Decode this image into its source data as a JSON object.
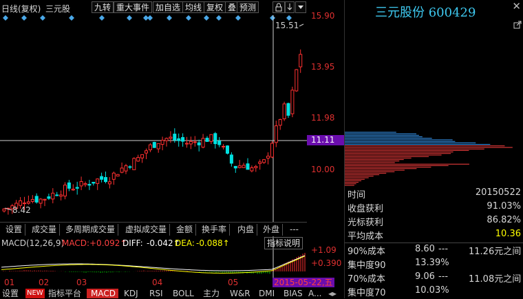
{
  "toolbar": {
    "period": "日线(复权)",
    "stock_name": "三元股",
    "buttons": [
      "九转",
      "重大事件",
      "加自选",
      "均线",
      "复权",
      "叠",
      "预测"
    ],
    "lock_icon": "lock-icon",
    "arrow_icon": "arrow-down-icon",
    "dropdown_icon": "dropdown-icon",
    "close_icon": "close-icon"
  },
  "price_axis": {
    "labels": [
      "15.90",
      "13.95",
      "11.98",
      "10.00"
    ],
    "current_price": "11.11"
  },
  "annotations": {
    "high_label": "15.51",
    "low_label": "8.42"
  },
  "indicator_tabs": [
    "设置",
    "成交量",
    "多周期成交量",
    "虚拟成交量",
    "金额",
    "换手率",
    "内盘",
    "外盘",
    "---"
  ],
  "macd": {
    "name": "MACD(12,26,9)",
    "macd_label": "MACD:",
    "macd_value": "+0.092↑",
    "diff_label": "DIFF:",
    "diff_value": "-0.042↑",
    "dea_label": "DEA:",
    "dea_value": "-0.088↑",
    "help_button": "指标说明",
    "axis_top": "+1.09",
    "axis_mid": "+0.390",
    "colors": {
      "diff": "#ffffff",
      "dea": "#ffff00",
      "up": "#ff3030",
      "down": "#00d000"
    }
  },
  "timeline": {
    "months": [
      "01",
      "02",
      "03",
      "04",
      "05"
    ],
    "cursor_date": "2015-05-22,五"
  },
  "bottom_tabs": [
    "设置",
    "NEW",
    "指标平台",
    "MACD",
    "KDJ",
    "RSI",
    "BOLL",
    "主力",
    "W&R",
    "DMI",
    "BIAS",
    "A..."
  ],
  "right_panel": {
    "title": "三元股份 600429",
    "stats": [
      {
        "label": "时间",
        "value": "20150522"
      },
      {
        "label": "收盘获利",
        "value": "91.03%"
      },
      {
        "label": "光标获利",
        "value": "86.82%"
      },
      {
        "label": "平均成本",
        "value": "10.36"
      }
    ],
    "cost90_label": "90%成本",
    "cost90_low": "8.60",
    "cost90_sep": "---",
    "cost90_high": "11.26元之间",
    "conc90_label": "集中度90",
    "conc90_value": "13.39%",
    "cost70_label": "70%成本",
    "cost70_low": "9.06",
    "cost70_sep": "---",
    "cost70_high": "11.08元之间",
    "conc70_label": "集中度70",
    "conc70_value": "10.03%"
  }
}
